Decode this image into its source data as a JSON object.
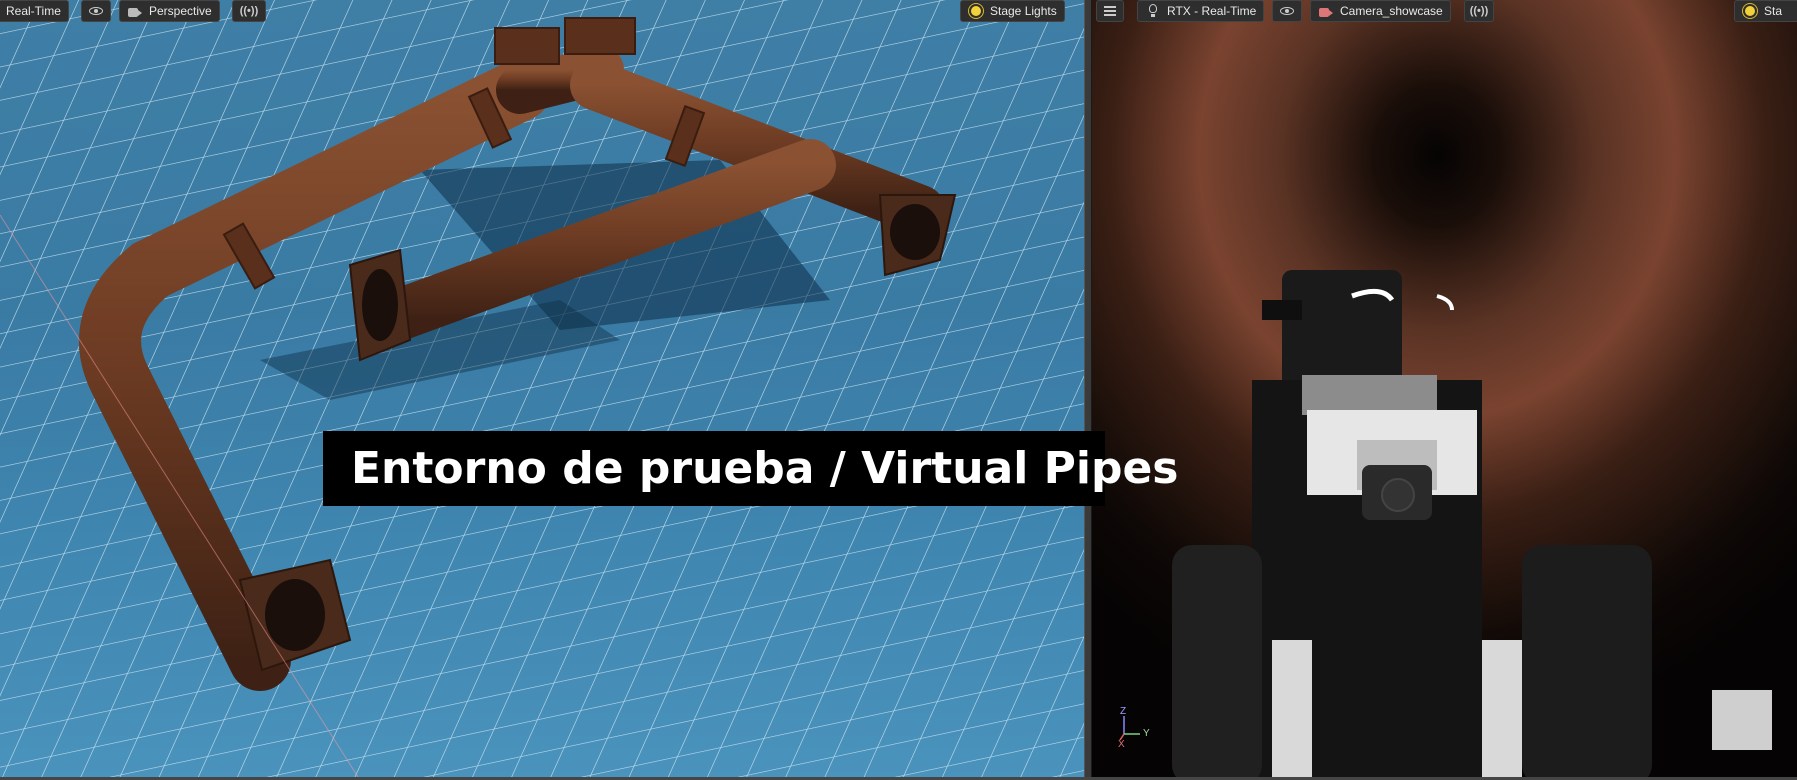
{
  "left_viewport": {
    "render_mode": "Real-Time",
    "camera": "Perspective",
    "lights": "Stage Lights"
  },
  "right_viewport": {
    "render_mode": "RTX - Real-Time",
    "camera": "Camera_showcase",
    "lights_truncated": "Sta"
  },
  "caption": "Entorno de prueba / Virtual Pipes",
  "axis_gizmo": {
    "z": "Z",
    "y": "Y",
    "x": "X"
  },
  "colors": {
    "grid_bg": "#3f7fa6",
    "pipe_rust": "#6b3a22",
    "tunnel_dark": "#0b0706",
    "robot_white": "#e6e6e6",
    "sun_yellow": "#f2d23a"
  },
  "icons": [
    "eye-icon",
    "camera-icon",
    "broadcast-icon",
    "sun-icon",
    "sliders-icon",
    "bulb-icon"
  ]
}
